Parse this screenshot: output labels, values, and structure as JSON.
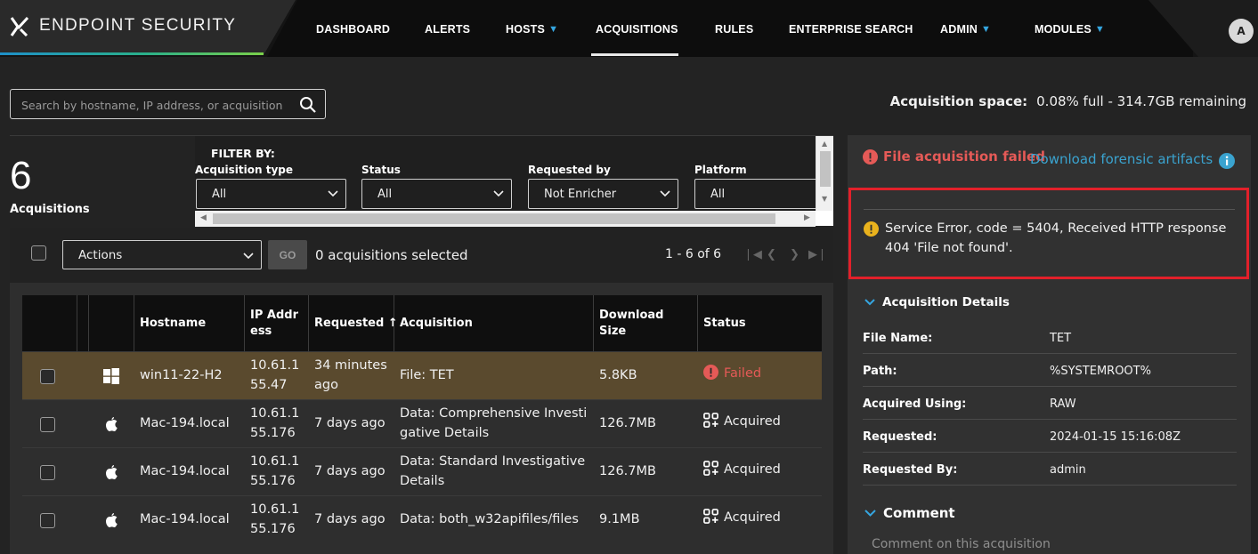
{
  "app": {
    "name": "ENDPOINT SECURITY",
    "avatar_initial": "A"
  },
  "nav": [
    {
      "label": "DASHBOARD",
      "dropdown": false,
      "active": false
    },
    {
      "label": "ALERTS",
      "dropdown": false,
      "active": false
    },
    {
      "label": "HOSTS",
      "dropdown": true,
      "active": false
    },
    {
      "label": "ACQUISITIONS",
      "dropdown": false,
      "active": true
    },
    {
      "label": "RULES",
      "dropdown": false,
      "active": false
    },
    {
      "label": "ENTERPRISE SEARCH",
      "dropdown": false,
      "active": false
    },
    {
      "label": "ADMIN",
      "dropdown": true,
      "active": false
    },
    {
      "label": "MODULES",
      "dropdown": true,
      "active": false
    }
  ],
  "search": {
    "placeholder": "Search by hostname, IP address, or acquisition"
  },
  "space": {
    "label": "Acquisition space:",
    "value": "0.08% full - 314.7GB remaining"
  },
  "summary": {
    "count": "6",
    "label": "Acquisitions"
  },
  "filters": {
    "title": "FILTER BY:",
    "items": [
      {
        "label": "Acquisition type",
        "value": "All"
      },
      {
        "label": "Status",
        "value": "All"
      },
      {
        "label": "Requested by",
        "value": "Not Enricher"
      },
      {
        "label": "Platform",
        "value": "All"
      }
    ]
  },
  "toolbar": {
    "actions_label": "Actions",
    "go_label": "GO",
    "selected_text": "0  acquisitions selected",
    "pager_text": "1 - 6 of 6",
    "pager_icons": [
      "first-page-icon",
      "prev-page-icon",
      "next-page-icon",
      "last-page-icon"
    ]
  },
  "table": {
    "columns": [
      "Hostname",
      "IP Address",
      "Requested",
      "Acquisition",
      "Download Size",
      "Status"
    ],
    "sort_indicator": "↑",
    "rows": [
      {
        "platform": "windows-icon",
        "hostname": "win11-22-H2",
        "ip": "10.61.155.47",
        "requested": "34 minutes ago",
        "acquisition": "File: TET",
        "size": "5.8KB",
        "status": "Failed",
        "selected": true
      },
      {
        "platform": "apple-icon",
        "hostname": "Mac-194.local",
        "ip": "10.61.155.176",
        "requested": "7 days ago",
        "acquisition": "Data: Comprehensive Investigative Details",
        "size": "126.7MB",
        "status": "Acquired",
        "selected": false
      },
      {
        "platform": "apple-icon",
        "hostname": "Mac-194.local",
        "ip": "10.61.155.176",
        "requested": "7 days ago",
        "acquisition": "Data: Standard Investigative Details",
        "size": "126.7MB",
        "status": "Acquired",
        "selected": false
      },
      {
        "platform": "apple-icon",
        "hostname": "Mac-194.local",
        "ip": "10.61.155.176",
        "requested": "7 days ago",
        "acquisition": "Data: both_w32apifiles/files",
        "size": "9.1MB",
        "status": "Acquired",
        "selected": false
      }
    ]
  },
  "detail": {
    "failure_title": "File acquisition failed",
    "download_link": "Download forensic artifacts",
    "error_message": "Service Error, code = 5404, Received HTTP response 404 'File not found'.",
    "details_heading": "Acquisition Details",
    "fields": [
      {
        "key": "File Name:",
        "value": "TET"
      },
      {
        "key": "Path:",
        "value": "%SYSTEMROOT%"
      },
      {
        "key": "Acquired Using:",
        "value": "RAW"
      },
      {
        "key": "Requested:",
        "value": "2024-01-15 15:16:08Z"
      },
      {
        "key": "Requested By:",
        "value": "admin"
      }
    ],
    "comment_heading": "Comment",
    "comment_placeholder": "Comment on this acquisition"
  },
  "colors": {
    "accent": "#35a6e0",
    "failed": "#e55a57",
    "highlight_row": "#5a4a2e",
    "error_border": "#e2202a"
  }
}
